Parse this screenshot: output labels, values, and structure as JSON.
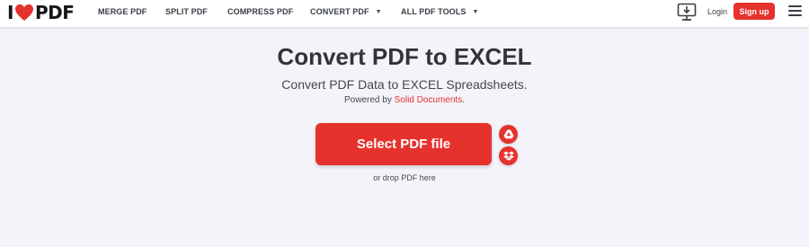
{
  "logo": {
    "left": "I",
    "right": "PDF",
    "heart_color": "#e5322d"
  },
  "nav": {
    "merge": "MERGE PDF",
    "split": "SPLIT PDF",
    "compress": "COMPRESS PDF",
    "convert": "CONVERT PDF",
    "all_tools": "ALL PDF TOOLS"
  },
  "header": {
    "login": "Login",
    "signup": "Sign up"
  },
  "main": {
    "title": "Convert PDF to EXCEL",
    "subtitle": "Convert PDF Data to EXCEL Spreadsheets.",
    "powered_prefix": "Powered by ",
    "powered_link": "Solid Documents",
    "powered_suffix": ".",
    "select_button": "Select PDF file",
    "drop_text": "or drop PDF here"
  },
  "icons": {
    "desktop": "desktop-download-icon",
    "menu": "hamburger-menu-icon",
    "google_drive": "google-drive-icon",
    "dropbox": "dropbox-icon",
    "caret": "caret-down-icon"
  },
  "colors": {
    "accent": "#e5322d",
    "background": "#f4f3f9",
    "text": "#33333b"
  }
}
